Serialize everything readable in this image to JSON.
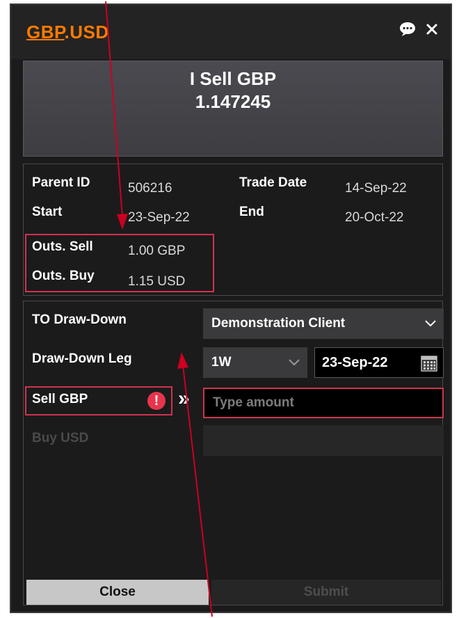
{
  "header": {
    "pair_base": "GBP",
    "pair_sep": ".",
    "pair_quote": "USD",
    "icons": [
      "chat-icon",
      "close-icon"
    ]
  },
  "quote": {
    "line1": "I Sell GBP",
    "line2": "1.147245"
  },
  "info": {
    "parent_id_label": "Parent ID",
    "parent_id_value": "506216",
    "trade_date_label": "Trade Date",
    "trade_date_value": "14-Sep-22",
    "start_label": "Start",
    "start_value": "23-Sep-22",
    "end_label": "End",
    "end_value": "20-Oct-22",
    "outs_sell_label": "Outs. Sell",
    "outs_sell_value": "1.00 GBP",
    "outs_buy_label": "Outs. Buy",
    "outs_buy_value": "1.15 USD"
  },
  "form": {
    "to_drawdown_label": "TO Draw-Down",
    "client_value": "Demonstration Client",
    "drawdown_leg_label": "Draw-Down Leg",
    "tenor_value": "1W",
    "date_value": "23-Sep-22",
    "sell_label": "Sell GBP",
    "buy_label": "Buy USD",
    "amount_placeholder": "Type amount",
    "error_glyph": "!",
    "arrows_glyph": "»"
  },
  "buttons": {
    "close": "Close",
    "submit": "Submit"
  },
  "colors": {
    "accent": "#ff7a00",
    "highlight": "#d0334f",
    "panel": "#1b1b1b"
  }
}
